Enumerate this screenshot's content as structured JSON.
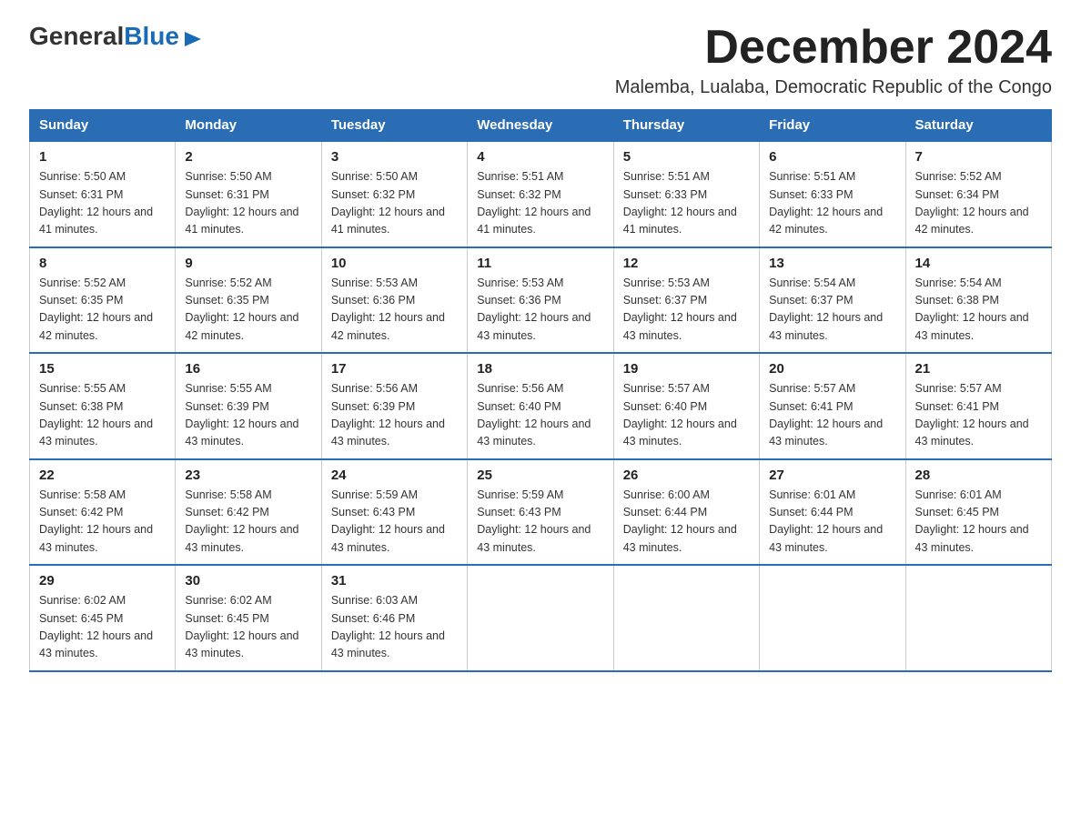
{
  "logo": {
    "text_general": "General",
    "text_blue": "Blue"
  },
  "title": "December 2024",
  "subtitle": "Malemba, Lualaba, Democratic Republic of the Congo",
  "days_of_week": [
    "Sunday",
    "Monday",
    "Tuesday",
    "Wednesday",
    "Thursday",
    "Friday",
    "Saturday"
  ],
  "weeks": [
    [
      {
        "num": "1",
        "sunrise": "5:50 AM",
        "sunset": "6:31 PM",
        "daylight": "12 hours and 41 minutes."
      },
      {
        "num": "2",
        "sunrise": "5:50 AM",
        "sunset": "6:31 PM",
        "daylight": "12 hours and 41 minutes."
      },
      {
        "num": "3",
        "sunrise": "5:50 AM",
        "sunset": "6:32 PM",
        "daylight": "12 hours and 41 minutes."
      },
      {
        "num": "4",
        "sunrise": "5:51 AM",
        "sunset": "6:32 PM",
        "daylight": "12 hours and 41 minutes."
      },
      {
        "num": "5",
        "sunrise": "5:51 AM",
        "sunset": "6:33 PM",
        "daylight": "12 hours and 41 minutes."
      },
      {
        "num": "6",
        "sunrise": "5:51 AM",
        "sunset": "6:33 PM",
        "daylight": "12 hours and 42 minutes."
      },
      {
        "num": "7",
        "sunrise": "5:52 AM",
        "sunset": "6:34 PM",
        "daylight": "12 hours and 42 minutes."
      }
    ],
    [
      {
        "num": "8",
        "sunrise": "5:52 AM",
        "sunset": "6:35 PM",
        "daylight": "12 hours and 42 minutes."
      },
      {
        "num": "9",
        "sunrise": "5:52 AM",
        "sunset": "6:35 PM",
        "daylight": "12 hours and 42 minutes."
      },
      {
        "num": "10",
        "sunrise": "5:53 AM",
        "sunset": "6:36 PM",
        "daylight": "12 hours and 42 minutes."
      },
      {
        "num": "11",
        "sunrise": "5:53 AM",
        "sunset": "6:36 PM",
        "daylight": "12 hours and 43 minutes."
      },
      {
        "num": "12",
        "sunrise": "5:53 AM",
        "sunset": "6:37 PM",
        "daylight": "12 hours and 43 minutes."
      },
      {
        "num": "13",
        "sunrise": "5:54 AM",
        "sunset": "6:37 PM",
        "daylight": "12 hours and 43 minutes."
      },
      {
        "num": "14",
        "sunrise": "5:54 AM",
        "sunset": "6:38 PM",
        "daylight": "12 hours and 43 minutes."
      }
    ],
    [
      {
        "num": "15",
        "sunrise": "5:55 AM",
        "sunset": "6:38 PM",
        "daylight": "12 hours and 43 minutes."
      },
      {
        "num": "16",
        "sunrise": "5:55 AM",
        "sunset": "6:39 PM",
        "daylight": "12 hours and 43 minutes."
      },
      {
        "num": "17",
        "sunrise": "5:56 AM",
        "sunset": "6:39 PM",
        "daylight": "12 hours and 43 minutes."
      },
      {
        "num": "18",
        "sunrise": "5:56 AM",
        "sunset": "6:40 PM",
        "daylight": "12 hours and 43 minutes."
      },
      {
        "num": "19",
        "sunrise": "5:57 AM",
        "sunset": "6:40 PM",
        "daylight": "12 hours and 43 minutes."
      },
      {
        "num": "20",
        "sunrise": "5:57 AM",
        "sunset": "6:41 PM",
        "daylight": "12 hours and 43 minutes."
      },
      {
        "num": "21",
        "sunrise": "5:57 AM",
        "sunset": "6:41 PM",
        "daylight": "12 hours and 43 minutes."
      }
    ],
    [
      {
        "num": "22",
        "sunrise": "5:58 AM",
        "sunset": "6:42 PM",
        "daylight": "12 hours and 43 minutes."
      },
      {
        "num": "23",
        "sunrise": "5:58 AM",
        "sunset": "6:42 PM",
        "daylight": "12 hours and 43 minutes."
      },
      {
        "num": "24",
        "sunrise": "5:59 AM",
        "sunset": "6:43 PM",
        "daylight": "12 hours and 43 minutes."
      },
      {
        "num": "25",
        "sunrise": "5:59 AM",
        "sunset": "6:43 PM",
        "daylight": "12 hours and 43 minutes."
      },
      {
        "num": "26",
        "sunrise": "6:00 AM",
        "sunset": "6:44 PM",
        "daylight": "12 hours and 43 minutes."
      },
      {
        "num": "27",
        "sunrise": "6:01 AM",
        "sunset": "6:44 PM",
        "daylight": "12 hours and 43 minutes."
      },
      {
        "num": "28",
        "sunrise": "6:01 AM",
        "sunset": "6:45 PM",
        "daylight": "12 hours and 43 minutes."
      }
    ],
    [
      {
        "num": "29",
        "sunrise": "6:02 AM",
        "sunset": "6:45 PM",
        "daylight": "12 hours and 43 minutes."
      },
      {
        "num": "30",
        "sunrise": "6:02 AM",
        "sunset": "6:45 PM",
        "daylight": "12 hours and 43 minutes."
      },
      {
        "num": "31",
        "sunrise": "6:03 AM",
        "sunset": "6:46 PM",
        "daylight": "12 hours and 43 minutes."
      },
      null,
      null,
      null,
      null
    ]
  ],
  "colors": {
    "header_bg": "#2a6db5",
    "border": "#2a6db5"
  }
}
